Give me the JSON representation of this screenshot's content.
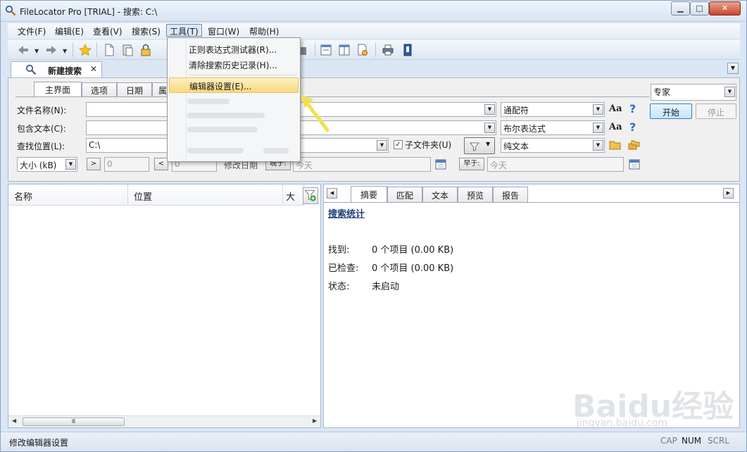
{
  "window": {
    "title": "FileLocator Pro [TRIAL] - 搜索: C:\\"
  },
  "menubar": {
    "items": [
      "文件(F)",
      "编辑(E)",
      "查看(V)",
      "搜索(S)",
      "工具(T)",
      "窗口(W)",
      "帮助(H)"
    ],
    "active": "工具(T)"
  },
  "tools_menu": {
    "items": [
      "正则表达式测试器(R)...",
      "清除搜索历史记录(H)...",
      "编辑器设置(E)..."
    ],
    "highlighted": "编辑器设置(E)..."
  },
  "doc_tab": {
    "label": "新建搜索",
    "close": "✕"
  },
  "criteria": {
    "tabs": [
      "主界面",
      "选项",
      "日期",
      "属"
    ],
    "selected_tab": "主界面",
    "labels": {
      "file_name": "文件名称(N):",
      "contains_text": "包含文本(C):",
      "look_in": "查找位置(L):"
    },
    "look_in_value": "C:\\",
    "file_name_mode": "通配符",
    "text_mode": "布尔表达式",
    "text_type": "纯文本",
    "subfolders": {
      "label": "子文件夹(U)",
      "checked": true
    },
    "size_mode": "大小 (kB)",
    "size_gt": ">",
    "size_gt_value": "0",
    "size_lt": "<",
    "size_lt_value": "0",
    "modified_label": "修改日期",
    "later_than": "晚于:",
    "later_value": "今天",
    "earlier_than": "早于:",
    "earlier_value": "今天",
    "aa": "Aa",
    "help": "?",
    "mode_select": "专家",
    "start": "开始",
    "stop": "停止"
  },
  "results": {
    "columns": [
      "名称",
      "位置",
      "大小"
    ],
    "scroll_grip": "Ⅲ"
  },
  "detail": {
    "tabs": [
      "摘要",
      "匹配",
      "文本",
      "预览",
      "报告"
    ],
    "selected_tab": "摘要",
    "stats_title": "搜索统计",
    "stats": [
      {
        "label": "找到:",
        "value": "0 个项目 (0.00 KB)"
      },
      {
        "label": "已检查:",
        "value": "0 个项目 (0.00 KB)"
      },
      {
        "label": "状态:",
        "value": "未启动"
      }
    ]
  },
  "statusbar": {
    "text": "修改编辑器设置",
    "indicators": [
      "CAP",
      "NUM",
      "SCRL"
    ],
    "active": "NUM"
  },
  "watermark": {
    "main": "Baidu经验",
    "sub": "jingyan.baidu.com"
  },
  "colors": {
    "accent": "#2a6fd0",
    "highlight": "#f9d77d",
    "arrow": "#f2e04a"
  }
}
